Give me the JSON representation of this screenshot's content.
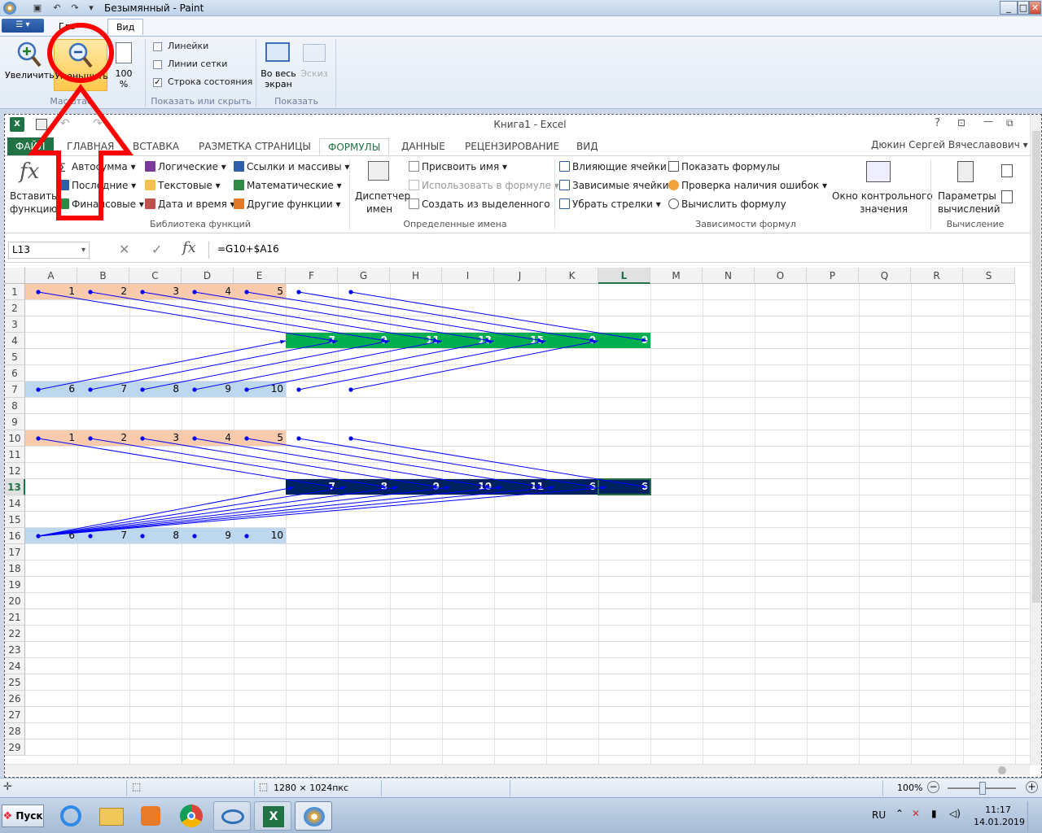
{
  "paint": {
    "title": "Безымянный - Paint",
    "tabs": [
      "Гла",
      "Вид"
    ],
    "zoom": {
      "in_label": "Увеличить",
      "out_label": "Уменьшить",
      "pct_label_1": "100",
      "pct_label_2": "%",
      "group": "Масштаб"
    },
    "show_hide": {
      "rulers": "Линейки",
      "gridlines": "Линии сетки",
      "status": "Строка состояния",
      "group": "Показать или скрыть"
    },
    "display": {
      "fullscreen_1": "Во весь",
      "fullscreen_2": "экран",
      "thumb": "Эскиз",
      "group": "Показать"
    },
    "status": {
      "size": "1280 × 1024пкс",
      "zoom": "100%"
    }
  },
  "excel": {
    "title": "Книга1 - Excel",
    "user": "Дюкин Сергей Вячеславович",
    "tabs": {
      "file": "ФАЙЛ",
      "home": "ГЛАВНАЯ",
      "insert": "ВСТАВКА",
      "layout": "РАЗМЕТКА СТРАНИЦЫ",
      "formulas": "ФОРМУЛЫ",
      "data": "ДАННЫЕ",
      "review": "РЕЦЕНЗИРОВАНИЕ",
      "view": "ВИД"
    },
    "ribbon": {
      "insert_fn_1": "Вставить",
      "insert_fn_2": "функцию",
      "autosum": "Автосумма",
      "recent": "Последние",
      "financial": "Финансовые",
      "logical": "Логические",
      "text": "Текстовые",
      "datetime": "Дата и время",
      "lookup": "Ссылки и массивы",
      "math": "Математические",
      "other": "Другие функции",
      "lib_group": "Библиотека функций",
      "name_mgr_1": "Диспетчер",
      "name_mgr_2": "имен",
      "define_name": "Присвоить имя",
      "use_in_formula": "Использовать в формуле",
      "create_sel": "Создать из выделенного",
      "names_group": "Определенные имена",
      "precedents": "Влияющие ячейки",
      "dependents": "Зависимые ячейки",
      "remove_arrows": "Убрать стрелки",
      "show_formulas": "Показать формулы",
      "error_check": "Проверка наличия ошибок",
      "eval_formula": "Вычислить формулу",
      "watch_1": "Окно контрольного",
      "watch_2": "значения",
      "audit_group": "Зависимости формул",
      "calc_opts_1": "Параметры",
      "calc_opts_2": "вычислений",
      "calc_group": "Вычисление"
    },
    "namebox": "L13",
    "formula": "=G10+$A16",
    "columns": [
      "A",
      "B",
      "C",
      "D",
      "E",
      "F",
      "G",
      "H",
      "I",
      "J",
      "K",
      "L",
      "M",
      "N",
      "O",
      "P",
      "Q",
      "R",
      "S"
    ],
    "rows": [
      "1",
      "2",
      "3",
      "4",
      "5",
      "6",
      "7",
      "8",
      "9",
      "10",
      "11",
      "12",
      "13",
      "14",
      "15",
      "16",
      "17",
      "18",
      "19",
      "20",
      "21",
      "22",
      "23",
      "24",
      "25",
      "26",
      "27",
      "28",
      "29"
    ],
    "row1": [
      "1",
      "2",
      "3",
      "4",
      "5"
    ],
    "row4": [
      "7",
      "9",
      "11",
      "13",
      "15",
      "0",
      "0"
    ],
    "row7": [
      "6",
      "7",
      "8",
      "9",
      "10"
    ],
    "row10": [
      "1",
      "2",
      "3",
      "4",
      "5"
    ],
    "row13": [
      "7",
      "8",
      "9",
      "10",
      "11",
      "6",
      "6"
    ],
    "row16": [
      "6",
      "7",
      "8",
      "9",
      "10"
    ]
  },
  "taskbar": {
    "start": "Пуск",
    "lang": "RU",
    "time": "11:17",
    "date": "14.01.2019"
  },
  "colors": {
    "peach": "#f8cbad",
    "blue_light": "#bdd7ee",
    "green": "#00b050",
    "navy": "#002060",
    "arrow": "#0000ff",
    "annotation": "#ff0000"
  }
}
